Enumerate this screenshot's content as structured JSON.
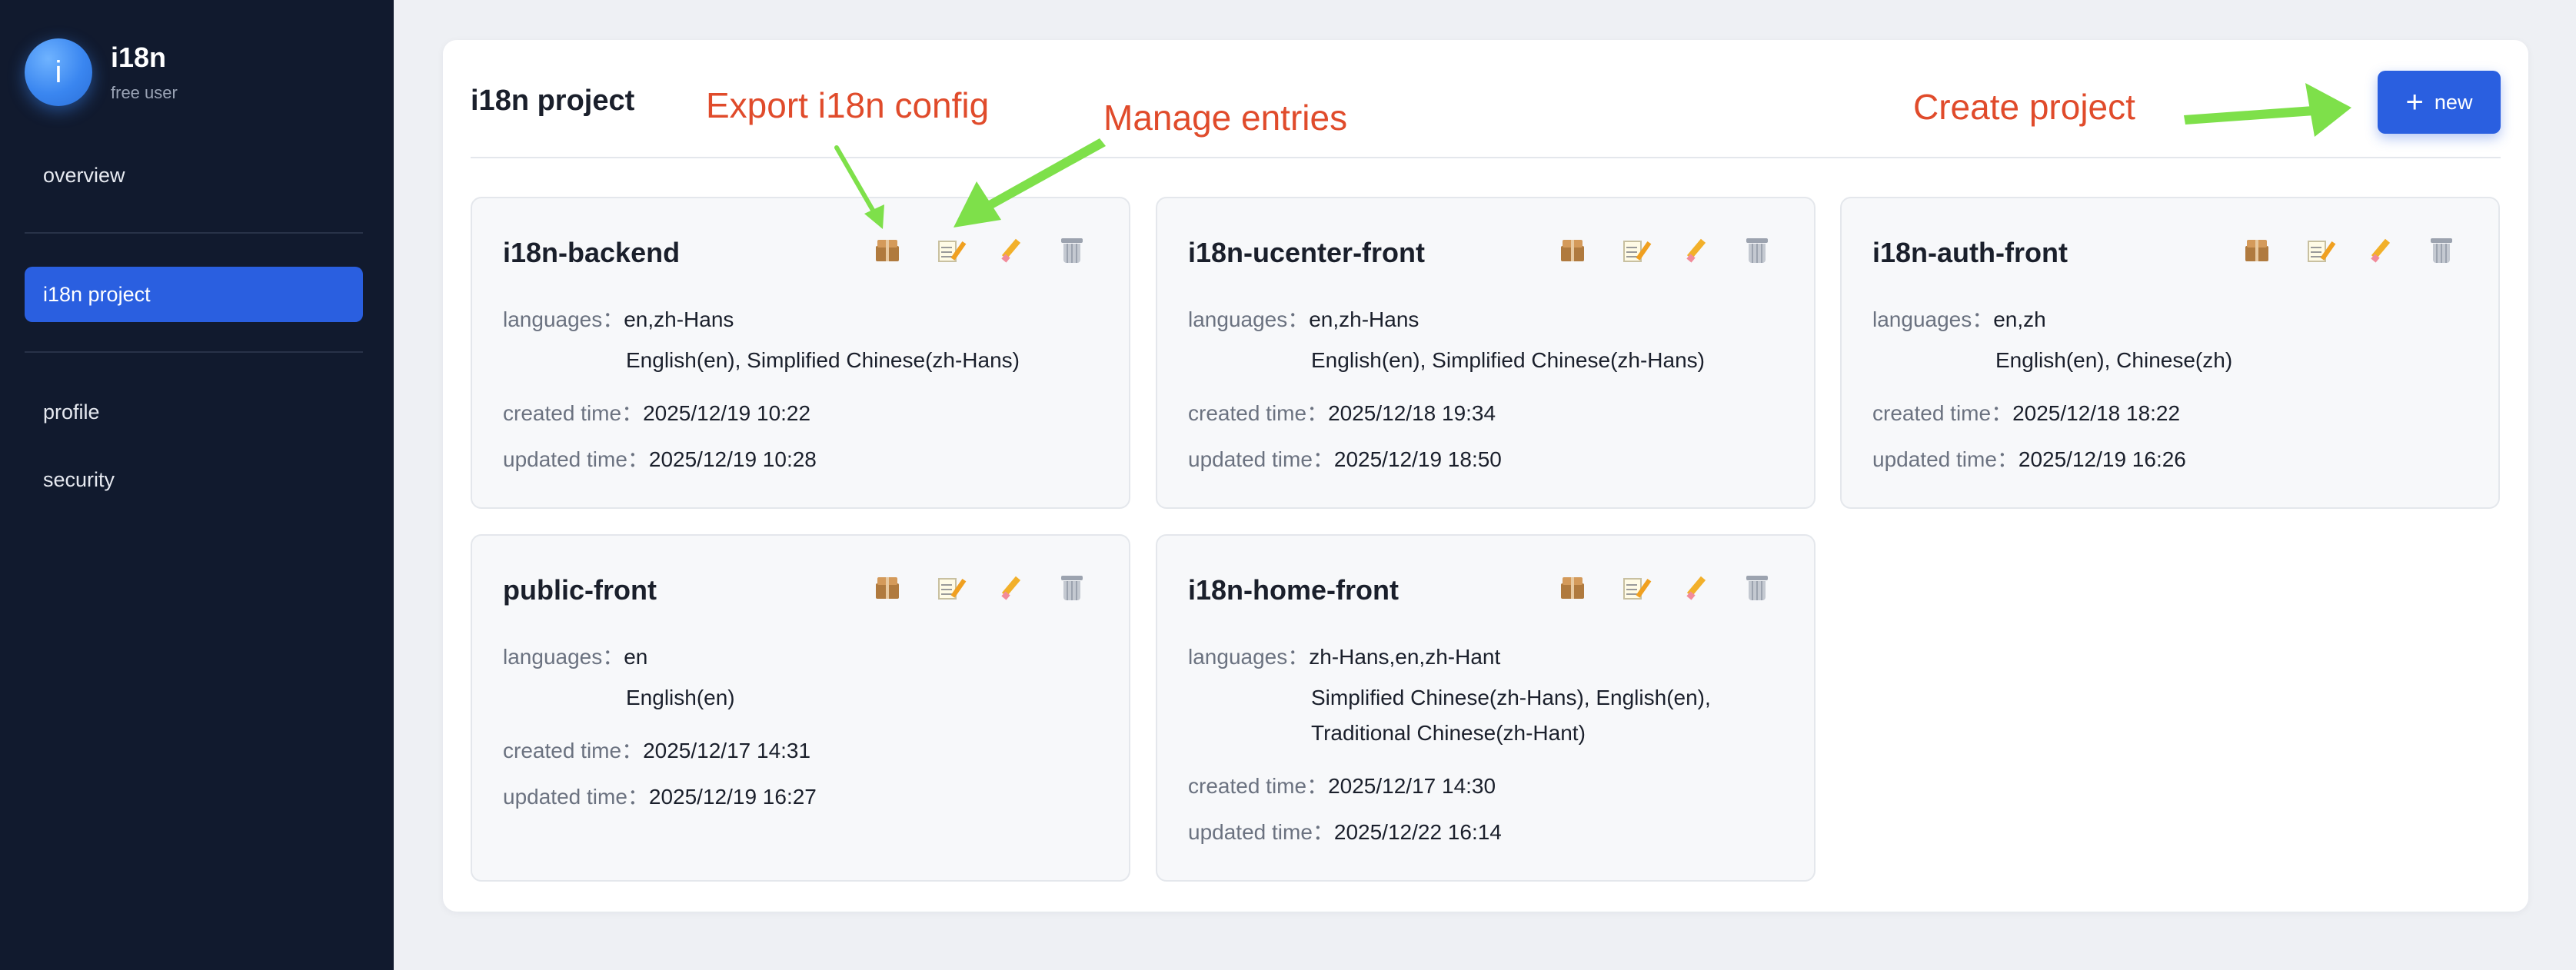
{
  "sidebar": {
    "avatar_letter": "i",
    "app_name": "i18n",
    "user_tier": "free user",
    "items": [
      {
        "label": "overview"
      },
      {
        "label": "i18n project"
      },
      {
        "label": "profile"
      },
      {
        "label": "security"
      }
    ]
  },
  "main": {
    "title": "i18n project",
    "new_button_label": "new"
  },
  "labels": {
    "languages": "languages：",
    "created": "created time：",
    "updated": "updated time："
  },
  "projects": [
    {
      "name": "i18n-backend",
      "languages": "en,zh-Hans",
      "languages_full": "English(en), Simplified Chinese(zh-Hans)",
      "created": "2025/12/19 10:22",
      "updated": "2025/12/19 10:28"
    },
    {
      "name": "i18n-ucenter-front",
      "languages": "en,zh-Hans",
      "languages_full": "English(en), Simplified Chinese(zh-Hans)",
      "created": "2025/12/18 19:34",
      "updated": "2025/12/19 18:50"
    },
    {
      "name": "i18n-auth-front",
      "languages": "en,zh",
      "languages_full": "English(en), Chinese(zh)",
      "created": "2025/12/18 18:22",
      "updated": "2025/12/19 16:26"
    },
    {
      "name": "public-front",
      "languages": "en",
      "languages_full": "English(en)",
      "created": "2025/12/17 14:31",
      "updated": "2025/12/19 16:27"
    },
    {
      "name": "i18n-home-front",
      "languages": "zh-Hans,en,zh-Hant",
      "languages_full": "Simplified Chinese(zh-Hans), English(en), Traditional Chinese(zh-Hant)",
      "created": "2025/12/17 14:30",
      "updated": "2025/12/22 16:14"
    }
  ],
  "annotations": {
    "export": "Export i18n config",
    "manage": "Manage entries",
    "create": "Create project"
  },
  "icons": [
    "package-icon",
    "memo-icon",
    "pencil-icon",
    "trash-icon"
  ],
  "colors": {
    "sidebar_bg": "#111a2e",
    "accent": "#2a5fe0",
    "annotation_text": "#e04b2b",
    "annotation_arrow": "#7ee04a"
  }
}
